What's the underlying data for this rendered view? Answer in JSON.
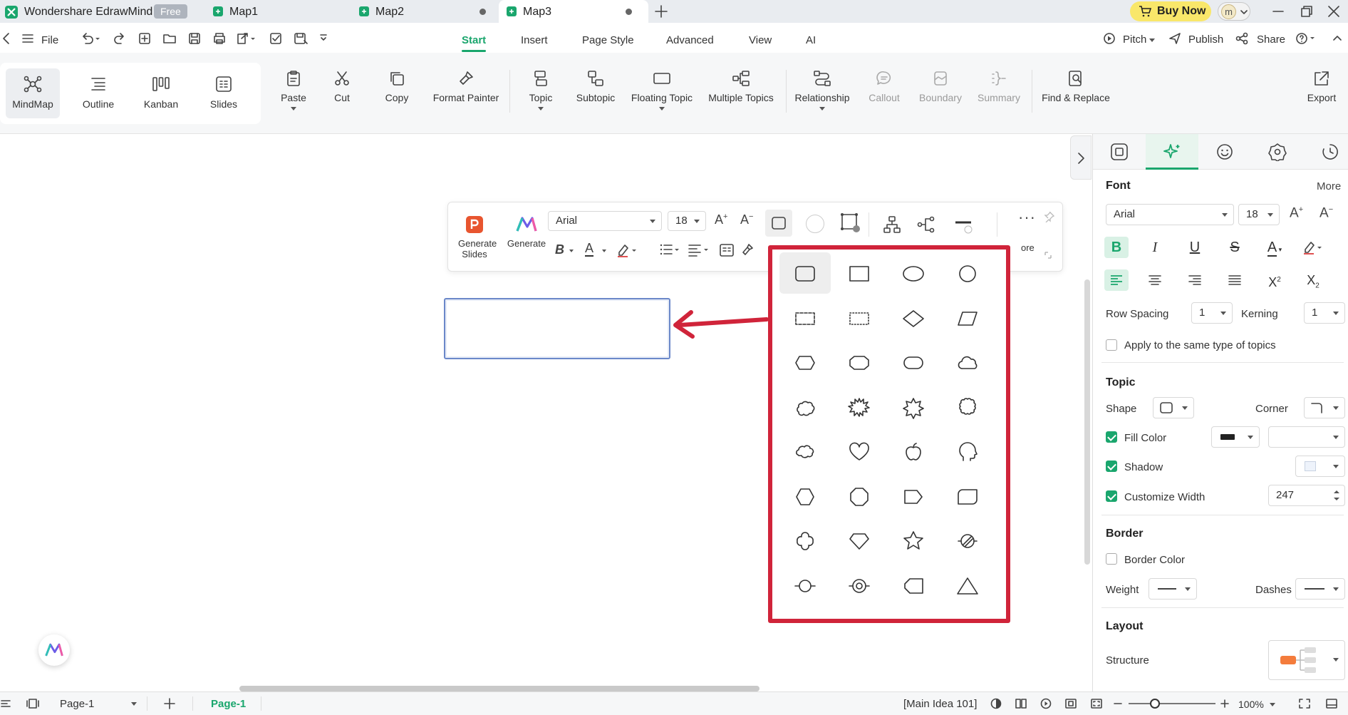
{
  "titlebar": {
    "app_name": "Wondershare EdrawMind",
    "badge": "Free",
    "tabs": [
      {
        "label": "Map1"
      },
      {
        "label": "Map2"
      },
      {
        "label": "Map3"
      }
    ],
    "buy_now": "Buy Now",
    "avatar_letter": "m"
  },
  "menubar": {
    "file": "File",
    "tabs": [
      "Start",
      "Insert",
      "Page Style",
      "Advanced",
      "View",
      "AI"
    ],
    "active_tab": "Start",
    "pitch": "Pitch",
    "publish": "Publish",
    "share": "Share"
  },
  "ribbon": {
    "views": [
      "MindMap",
      "Outline",
      "Kanban",
      "Slides"
    ],
    "active_view": "MindMap",
    "buttons": {
      "paste": "Paste",
      "cut": "Cut",
      "copy": "Copy",
      "format_painter": "Format Painter",
      "topic": "Topic",
      "subtopic": "Subtopic",
      "floating_topic": "Floating Topic",
      "multiple_topics": "Multiple Topics",
      "relationship": "Relationship",
      "callout": "Callout",
      "boundary": "Boundary",
      "summary": "Summary",
      "find_replace": "Find & Replace",
      "export": "Export"
    }
  },
  "floating_toolbar": {
    "generate_slides_line1": "Generate",
    "generate_slides_line2": "Slides",
    "generate": "Generate",
    "font": "Arial",
    "size": "18",
    "more_partial": "ore"
  },
  "shape_panel": {
    "shapes": [
      "rounded-rectangle",
      "rectangle",
      "ellipse",
      "circle",
      "dashed-rectangle",
      "dotted-rectangle",
      "diamond",
      "parallelogram",
      "hexagon-flat",
      "octagon-flat",
      "pill",
      "cloud",
      "cloud-bumpy",
      "burst-spiky",
      "burst-star",
      "scalloped-circle",
      "brain-cloud",
      "heart",
      "apple",
      "head",
      "hexagon",
      "octagon",
      "pentagon-arrow",
      "rounded-tab",
      "cross-rounded",
      "gem",
      "star",
      "circle-slash",
      "circle-line",
      "circle-target",
      "tag-left",
      "triangle"
    ],
    "selected": "rounded-rectangle",
    "annotation_color": "#d0243a"
  },
  "right_panel": {
    "font_section": "Font",
    "more": "More",
    "font_family": "Arial",
    "font_size": "18",
    "row_spacing_label": "Row Spacing",
    "row_spacing": "1",
    "kerning_label": "Kerning",
    "kerning": "1",
    "apply_same_label": "Apply to the same type of topics",
    "topic_section": "Topic",
    "shape_label": "Shape",
    "corner_label": "Corner",
    "fill_color_label": "Fill Color",
    "shadow_label": "Shadow",
    "customize_width_label": "Customize Width",
    "customize_width": "247",
    "border_section": "Border",
    "border_color_label": "Border Color",
    "weight_label": "Weight",
    "dashes_label": "Dashes",
    "layout_section": "Layout",
    "structure_label": "Structure",
    "accent": "#1aa66d"
  },
  "statusbar": {
    "page_select": "Page-1",
    "page_tab": "Page-1",
    "selection": "[Main Idea 101]",
    "zoom": "100%"
  }
}
